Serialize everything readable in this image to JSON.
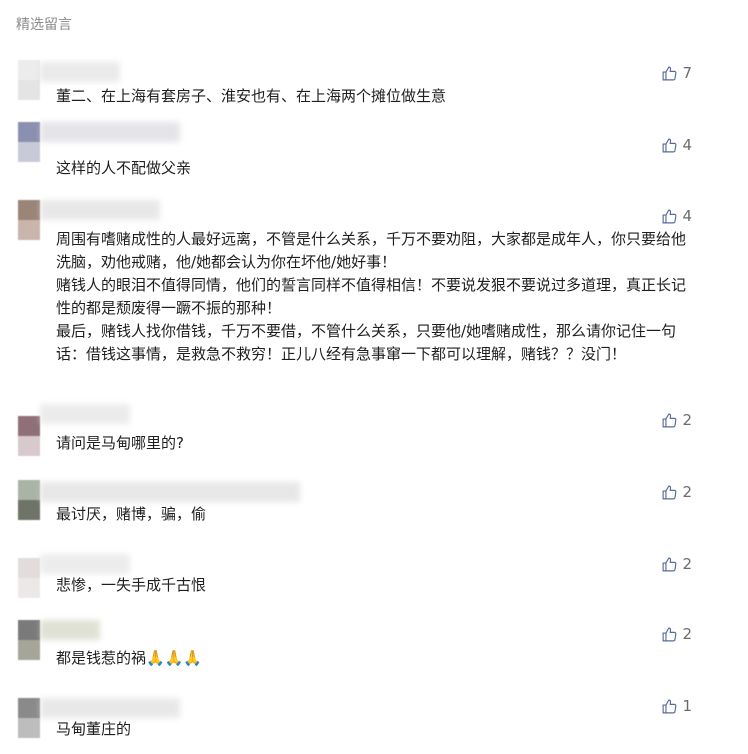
{
  "section_title": "精选留言",
  "colors": {
    "text": "#1f1f1f",
    "muted": "#8c8c8c",
    "like": "#6b6b6b",
    "accent": "#576b95"
  },
  "comments": [
    {
      "text": "董二、在上海有套房子、淮安也有、在上海两个摊位做生意",
      "likes": "7"
    },
    {
      "text": "这样的人不配做父亲",
      "likes": "4"
    },
    {
      "text": "周围有嗜赌成性的人最好远离，不管是什么关系，千万不要劝阻，大家都是成年人，你只要给他洗脑，劝他戒赌，他/她都会认为你在坏他/她好事！\n赌钱人的眼泪不值得同情，他们的誓言同样不值得相信！不要说发狠不要说过多道理，真正长记性的都是颓废得一蹶不振的那种！\n最后，赌钱人找你借钱，千万不要借，不管什么关系，只要他/她嗜赌成性，那么请你记住一句话：借钱这事情，是救急不救穷！正儿八经有急事窜一下都可以理解，赌钱？？没门！",
      "likes": "4"
    },
    {
      "text": "请问是马甸哪里的?",
      "likes": "2"
    },
    {
      "text": "最讨厌，赌博，骗，偷",
      "likes": "2"
    },
    {
      "text": "悲惨，一失手成千古恨",
      "likes": "2"
    },
    {
      "text": "都是钱惹的祸🙏🙏🙏",
      "likes": "2"
    },
    {
      "text": "马甸董庄的",
      "likes": "1"
    }
  ]
}
